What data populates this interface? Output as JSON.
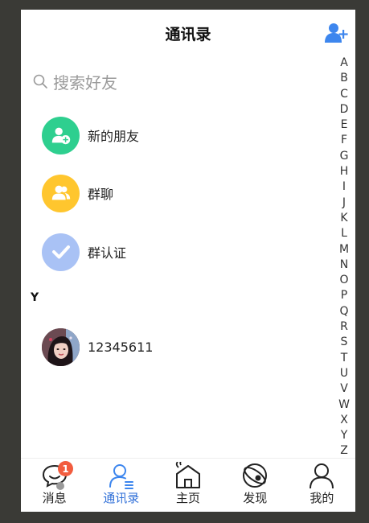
{
  "header": {
    "title": "通讯录"
  },
  "search": {
    "placeholder": "搜索好友"
  },
  "items": [
    {
      "label": "新的朋友",
      "icon": "new-friend-icon",
      "color": "#2ecf8f"
    },
    {
      "label": "群聊",
      "icon": "group-chat-icon",
      "color": "#ffc62e"
    },
    {
      "label": "群认证",
      "icon": "check-icon",
      "color": "#a9c2f5"
    }
  ],
  "section": {
    "letter": "Y"
  },
  "contacts": [
    {
      "name": "12345611"
    }
  ],
  "index_letters": [
    "A",
    "B",
    "C",
    "D",
    "E",
    "F",
    "G",
    "H",
    "I",
    "J",
    "K",
    "L",
    "M",
    "N",
    "O",
    "P",
    "Q",
    "R",
    "S",
    "T",
    "U",
    "V",
    "W",
    "X",
    "Y",
    "Z"
  ],
  "tabbar": {
    "tabs": [
      {
        "label": "消息",
        "icon": "message-icon",
        "badge": "1"
      },
      {
        "label": "通讯录",
        "icon": "contacts-icon",
        "active": true
      },
      {
        "label": "主页",
        "icon": "home-icon"
      },
      {
        "label": "发现",
        "icon": "discover-icon"
      },
      {
        "label": "我的",
        "icon": "profile-icon"
      }
    ]
  },
  "colors": {
    "accent": "#2f6fd8",
    "badge": "#f25c3e"
  }
}
